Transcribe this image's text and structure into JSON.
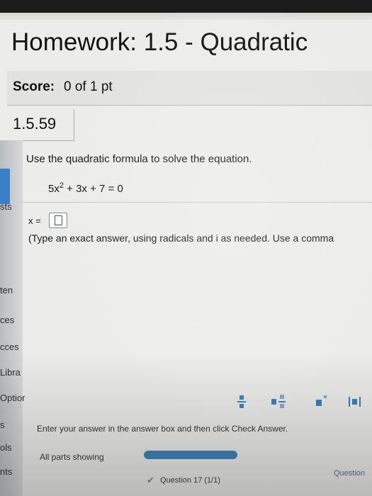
{
  "header": {
    "title": "Homework: 1.5 - Quadratic"
  },
  "score": {
    "label": "Score:",
    "value": "0 of 1 pt"
  },
  "question": {
    "number": "1.5.59",
    "instructions": "Use the quadratic formula to solve the equation.",
    "equation_lead": "5x",
    "equation_exponent": "2",
    "equation_rest": " + 3x + 7 = 0",
    "answer_label": "x =",
    "answer_value": "",
    "answer_hint": "(Type an exact answer, using radicals and i as needed. Use a comma"
  },
  "sidebar": {
    "labels": [
      "sts",
      "ten",
      "ces",
      "cces",
      "Libra",
      "Optior",
      "s",
      "ols",
      "nts"
    ]
  },
  "toolbar": {
    "buttons": [
      "fraction-icon",
      "mixed-number-icon",
      "exponent-icon",
      "absolute-value-icon"
    ]
  },
  "footer": {
    "enter_message": "Enter your answer in the answer box and then click Check Answer.",
    "parts_label": "All parts showing",
    "progress_fraction": 1.0,
    "question_status": "Question 17 (1/1)",
    "question_link": "Question"
  },
  "colors": {
    "accent": "#3a7fb8",
    "check": "#4ea94e",
    "side_tab": "#3b7fc4"
  }
}
